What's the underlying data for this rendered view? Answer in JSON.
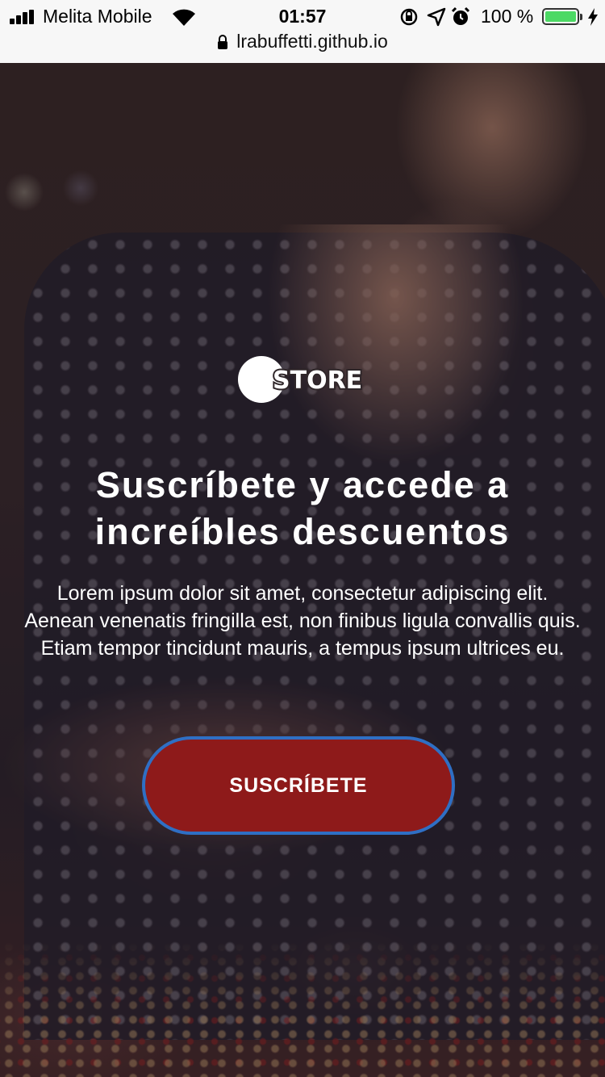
{
  "status_bar": {
    "carrier": "Melita Mobile",
    "time": "01:57",
    "battery_percent": "100 %",
    "battery_level": 1.0,
    "url": "lrabuffetti.github.io",
    "icons": [
      "signal-icon",
      "wifi-icon",
      "rotation-lock-icon",
      "location-icon",
      "alarm-icon",
      "battery-icon",
      "charging-icon",
      "lock-icon"
    ]
  },
  "hero": {
    "logo_text": "STORE",
    "headline": "Suscríbete y accede a increíbles descuentos",
    "body": "Lorem ipsum dolor sit amet, consectetur adipiscing elit. Aenean venenatis fringilla est, non finibus ligula convallis quis. Etiam tempor tincidunt mauris, a tempus ipsum ultrices eu.",
    "cta_label": "SUSCRÍBETE"
  },
  "colors": {
    "cta_background": "#8e1a1a",
    "cta_border": "#2f6fc4",
    "battery_fill": "#4cd964",
    "text": "#ffffff"
  }
}
